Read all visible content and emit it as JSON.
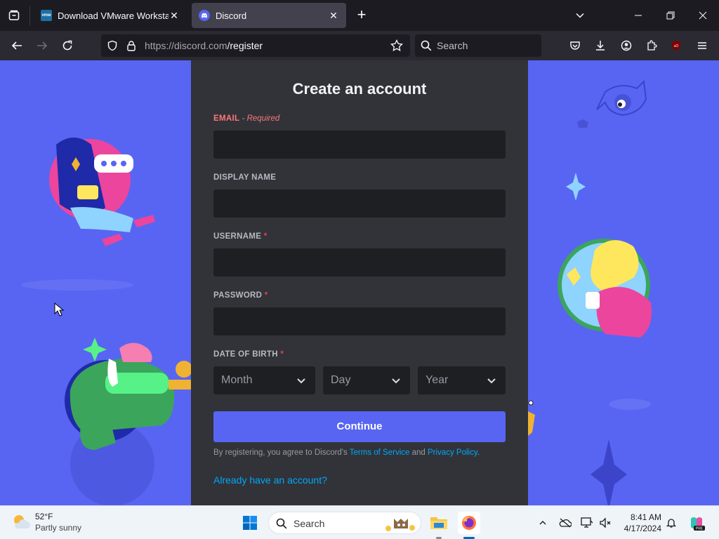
{
  "browser": {
    "tabs": [
      {
        "title": "Download VMware Workstation",
        "favicon_text": "vmw",
        "active": false
      },
      {
        "title": "Discord",
        "active": true
      }
    ],
    "url_host": "https://discord.com",
    "url_path": "/register",
    "search_placeholder": "Search"
  },
  "form": {
    "title": "Create an account",
    "email_label": "EMAIL",
    "email_required": "- Required",
    "display_name_label": "DISPLAY NAME",
    "username_label": "USERNAME",
    "password_label": "PASSWORD",
    "dob_label": "DATE OF BIRTH",
    "required_marker": "*",
    "month_placeholder": "Month",
    "day_placeholder": "Day",
    "year_placeholder": "Year",
    "continue_label": "Continue",
    "legal_prefix": "By registering, you agree to Discord's",
    "terms_link": "Terms of Service",
    "legal_and": "and",
    "privacy_link": "Privacy Policy",
    "legal_suffix": ".",
    "login_link": "Already have an account?"
  },
  "taskbar": {
    "weather_temp": "52°F",
    "weather_condition": "Partly sunny",
    "search_label": "Search",
    "time": "8:41 AM",
    "date": "4/17/2024"
  },
  "colors": {
    "discord_blurple": "#5865f2",
    "panel_bg": "#313338",
    "input_bg": "#1e1f22",
    "link": "#00a8fc",
    "error": "#fa777c"
  }
}
